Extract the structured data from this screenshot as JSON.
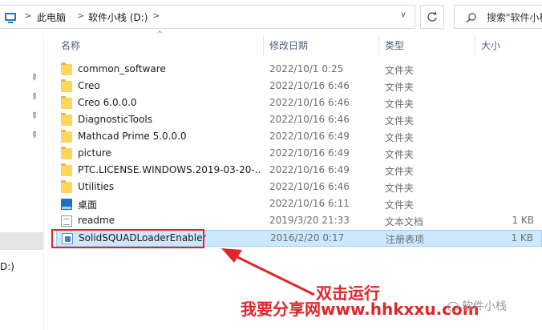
{
  "address_bar": {
    "breadcrumb": [
      "此电脑",
      "软件小栈 (D:)"
    ],
    "separator": ">",
    "dropdown_glyph": "v",
    "refresh_icon": "refresh-icon",
    "search_placeholder": "搜索\"软件小栈"
  },
  "nav_pane": {
    "drive_label": "D:)"
  },
  "columns": {
    "name": "名称",
    "date_modified": "修改日期",
    "type": "类型",
    "size": "大小"
  },
  "files": [
    {
      "name": "common_software",
      "date": "2022/10/1 0:25",
      "type": "文件夹",
      "size": "",
      "icon": "folder-icon"
    },
    {
      "name": "Creo",
      "date": "2022/10/16 6:46",
      "type": "文件夹",
      "size": "",
      "icon": "folder-icon"
    },
    {
      "name": "Creo 6.0.0.0",
      "date": "2022/10/16 6:46",
      "type": "文件夹",
      "size": "",
      "icon": "folder-icon"
    },
    {
      "name": "DiagnosticTools",
      "date": "2022/10/16 6:46",
      "type": "文件夹",
      "size": "",
      "icon": "folder-icon"
    },
    {
      "name": "Mathcad Prime 5.0.0.0",
      "date": "2022/10/16 6:49",
      "type": "文件夹",
      "size": "",
      "icon": "folder-icon"
    },
    {
      "name": "picture",
      "date": "2022/10/16 6:49",
      "type": "文件夹",
      "size": "",
      "icon": "folder-icon"
    },
    {
      "name": "PTC.LICENSE.WINDOWS.2019-03-20-...",
      "date": "2022/10/16 6:49",
      "type": "文件夹",
      "size": "",
      "icon": "folder-icon"
    },
    {
      "name": "Utilities",
      "date": "2022/10/16 6:46",
      "type": "文件夹",
      "size": "",
      "icon": "folder-icon"
    },
    {
      "name": "桌面",
      "date": "2022/10/16 6:11",
      "type": "文件夹",
      "size": "",
      "icon": "desktop-folder-icon"
    },
    {
      "name": "readme",
      "date": "2019/3/20 21:33",
      "type": "文本文档",
      "size": "1 KB",
      "icon": "text-document-icon"
    },
    {
      "name": "SolidSQUADLoaderEnabler",
      "date": "2016/2/20 0:17",
      "type": "注册表项",
      "size": "1 KB",
      "icon": "registry-file-icon",
      "selected": true
    }
  ],
  "annotation": {
    "label": "双击运行",
    "watermark": "我要分享网www.hhkxxu.com",
    "wechat_mark": "软件小栈",
    "color": "#e0252a"
  },
  "colors": {
    "selection_bg": "#cce8ff",
    "selection_border": "#99d1ff",
    "folder": "#ffd65c",
    "header_text": "#4c607a"
  }
}
